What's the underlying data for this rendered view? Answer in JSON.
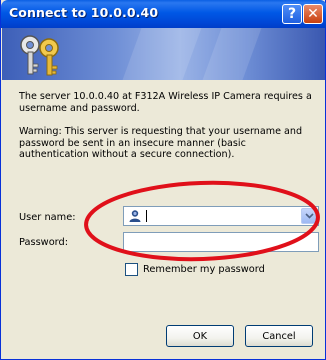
{
  "window": {
    "title": "Connect to 10.0.0.40",
    "help_glyph": "?",
    "close_glyph": "✕"
  },
  "message": {
    "line1": "The server 10.0.0.40 at F312A Wireless IP Camera requires a username and password.",
    "line2": "Warning: This server is requesting that your username and password be sent in an insecure manner (basic authentication without a secure connection)."
  },
  "form": {
    "username_label": "User name:",
    "username_value": "",
    "password_label": "Password:",
    "password_value": "",
    "remember_label": "Remember my password",
    "remember_checked": false
  },
  "buttons": {
    "ok_label": "OK",
    "cancel_label": "Cancel"
  },
  "colors": {
    "titlebar": "#0058e6",
    "annotation": "#e0101a"
  },
  "icons": [
    "keys-icon",
    "user-icon",
    "chevron-down-icon",
    "help-icon",
    "close-icon"
  ]
}
